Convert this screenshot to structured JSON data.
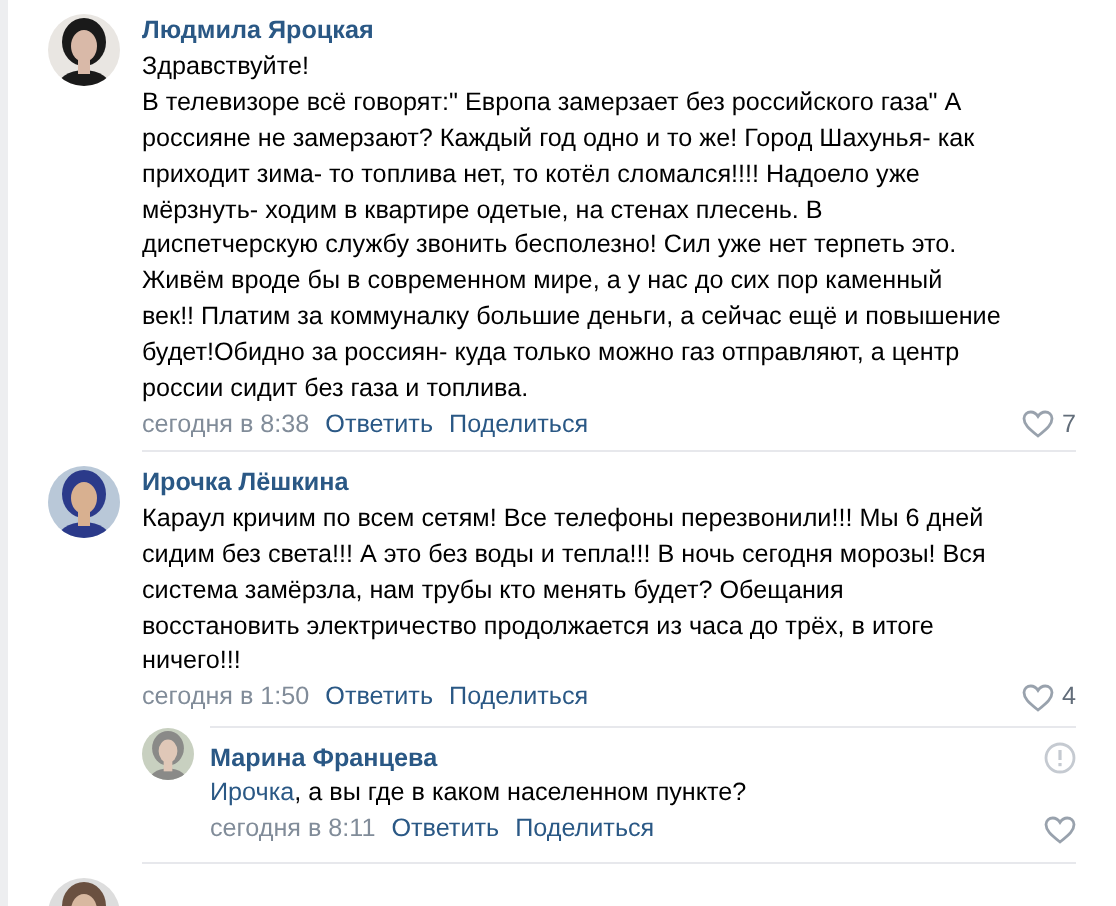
{
  "comments": [
    {
      "author": "Людмила Яроцкая",
      "text": "Здравствуйте!\nВ телевизоре всё говорят:\" Европа замерзает без российского газа\" А\nроссияне не замерзают? Каждый год одно и то же! Город Шахунья- как\nприходит зима- то топлива нет, то котёл сломался!!!! Надоело уже\nмёрзнуть- ходим в квартире одетые, на стенах плесень. В\nдиспетчерскую службу звонить бесполезно! Сил уже нет терпеть это.\nЖивём вроде бы в современном мире, а у нас до сих пор каменный\nвек!! Платим за коммуналку большие деньги, а сейчас ещё и повышение\nбудет!Обидно за россиян- куда только можно газ отправляют, а центр\nроссии сидит без газа и топлива.",
      "time": "сегодня в 8:38",
      "actions": [
        "Ответить",
        "Поделиться"
      ],
      "likes": "7"
    },
    {
      "author": "Ирочка Лёшкина",
      "text": "Караул кричим по всем сетям! Все телефоны перезвонили!!! Мы 6 дней\nсидим без света!!! А это без воды и тепла!!! В ночь сегодня морозы! Вся\nсистема замёрзла, нам трубы кто менять будет? Обещания\nвосстановить электричество продолжается из часа до трёх, в итоге\nничего!!!",
      "time": "сегодня в 1:50",
      "actions": [
        "Ответить",
        "Поделиться"
      ],
      "likes": "4",
      "replies": [
        {
          "author": "Марина Францева",
          "mention": "Ирочка",
          "text": ", а вы где в каком населенном пункте?",
          "time": "сегодня в 8:11",
          "actions": [
            "Ответить",
            "Поделиться"
          ]
        }
      ]
    },
    {
      "kind": "cut"
    }
  ]
}
